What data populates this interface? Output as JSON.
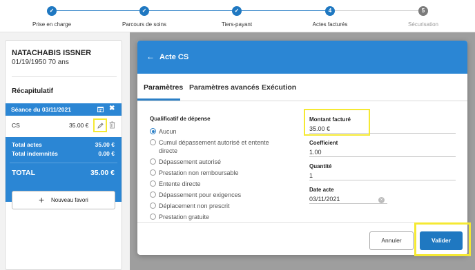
{
  "stepper": {
    "steps": [
      {
        "label": "Prise en charge",
        "mark": "✓"
      },
      {
        "label": "Parcours de soins",
        "mark": "✓"
      },
      {
        "label": "Tiers-payant",
        "mark": "✓"
      },
      {
        "label": "Actes facturés",
        "mark": "4"
      },
      {
        "label": "Sécurisation",
        "mark": "5"
      }
    ]
  },
  "patient": {
    "name": "NATACHABIS ISSNER",
    "meta": "01/19/1950 70 ans"
  },
  "recap": {
    "title": "Récapitulatif",
    "seance_label": "Séance du 03/11/2021",
    "close_glyph": "✖",
    "acte_code": "CS",
    "acte_amount": "35.00 €",
    "total_actes_label": "Total actes",
    "total_actes_value": "35.00 €",
    "total_indemnites_label": "Total indemnités",
    "total_indemnites_value": "0.00 €",
    "total_label": "TOTAL",
    "total_value": "35.00 €",
    "fav_plus": "+",
    "fav_label": "Nouveau favori"
  },
  "modal": {
    "back_glyph": "←",
    "title": "Acte CS",
    "tabs": [
      "Paramètres",
      "Paramètres avancés",
      "Exécution"
    ],
    "active_tab": 0,
    "qualificatif_title": "Qualificatif de dépense",
    "options": [
      "Aucun",
      "Cumul dépassement autorisé et entente directe",
      "Dépassement autorisé",
      "Prestation non remboursable",
      "Entente directe",
      "Dépassement pour exigences",
      "Déplacement non prescrit",
      "Prestation gratuite"
    ],
    "selected_option": 0,
    "montant_label": "Montant facturé",
    "montant_value": "35.00 €",
    "coefficient_label": "Coefficient",
    "coefficient_value": "1.00",
    "quantite_label": "Quantité",
    "quantite_value": "1",
    "date_label": "Date acte",
    "date_value": "03/11/2021",
    "date_clear_glyph": "×",
    "cancel_label": "Annuler",
    "ok_label": "Valider"
  },
  "colors": {
    "primary": "#2b86d4",
    "highlight": "#f5e933"
  }
}
